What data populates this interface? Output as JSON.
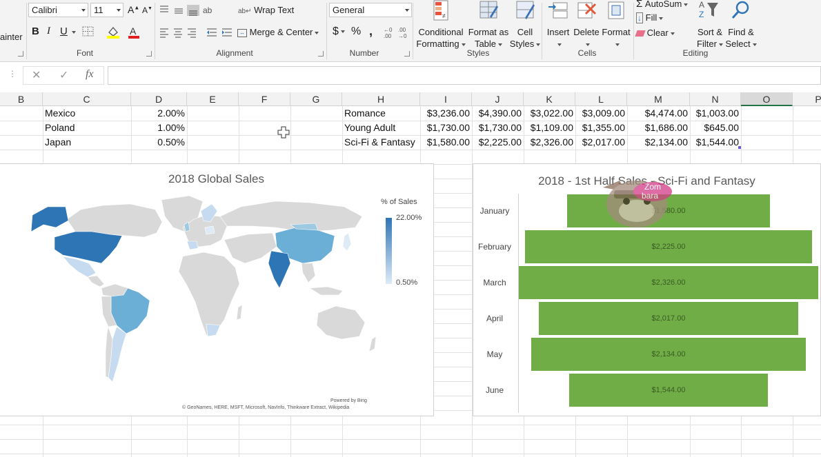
{
  "ribbon": {
    "clipboard_partial": "ainter",
    "font": {
      "name": "Calibri",
      "size": "11",
      "group_label": "Font"
    },
    "alignment": {
      "wrap_text": "Wrap Text",
      "merge_center": "Merge & Center",
      "group_label": "Alignment"
    },
    "number": {
      "format": "General",
      "currency": "$",
      "percent": "%",
      "comma": ",",
      "group_label": "Number"
    },
    "styles": {
      "conditional": [
        "Conditional",
        "Formatting"
      ],
      "format_table": [
        "Format as",
        "Table"
      ],
      "cell_styles": [
        "Cell",
        "Styles"
      ],
      "group_label": "Styles"
    },
    "cells": {
      "insert": "Insert",
      "delete": "Delete",
      "format": "Format",
      "group_label": "Cells"
    },
    "editing": {
      "autosum": "AutoSum",
      "fill": "Fill",
      "clear": "Clear",
      "sort": [
        "Sort &",
        "Filter"
      ],
      "find": [
        "Find &",
        "Select"
      ],
      "group_label": "Editing"
    }
  },
  "formula_bar": {
    "fx": "fx",
    "cancel": "✕",
    "enter": "✓",
    "value": ""
  },
  "columns": [
    "B",
    "C",
    "D",
    "E",
    "F",
    "G",
    "H",
    "I",
    "J",
    "K",
    "L",
    "M",
    "N",
    "O",
    "P"
  ],
  "rows": [
    {
      "country": "Mexico",
      "pct": "2.00%",
      "genre": "Romance",
      "vals": [
        "$3,236.00",
        "$4,390.00",
        "$3,022.00",
        "$3,009.00",
        "$4,474.00",
        "$1,003.00"
      ]
    },
    {
      "country": "Poland",
      "pct": "1.00%",
      "genre": "Young Adult",
      "vals": [
        "$1,730.00",
        "$1,730.00",
        "$1,109.00",
        "$1,355.00",
        "$1,686.00",
        "$645.00"
      ]
    },
    {
      "country": "Japan",
      "pct": "0.50%",
      "genre": "Sci-Fi & Fantasy",
      "vals": [
        "$1,580.00",
        "$2,225.00",
        "$2,326.00",
        "$2,017.00",
        "$2,134.00",
        "$1,544.00"
      ]
    }
  ],
  "map_chart": {
    "title": "2018 Global Sales",
    "legend_title": "% of Sales",
    "legend_max": "22.00%",
    "legend_min": "0.50%",
    "powered_by": "Powered by Bing",
    "attribution": "© GeoNames, HERE, MSFT, Microsoft, NavInfo, Thinkware Extract, Wikipedia",
    "colors": {
      "high": "#2e75b6",
      "low": "#deebf7",
      "land": "#d9d9d9"
    }
  },
  "watermark": "Zombara",
  "chart_data": {
    "type": "bar",
    "orientation": "horizontal",
    "title": "2018 - 1st Half Sales - Sci-Fi and Fantasy",
    "categories": [
      "January",
      "February",
      "March",
      "April",
      "May",
      "June"
    ],
    "values": [
      1580,
      2225,
      2326,
      2017,
      2134,
      1544
    ],
    "labels": [
      "$1,580.00",
      "$2,225.00",
      "$2,326.00",
      "$2,017.00",
      "$2,134.00",
      "$1,544.00"
    ],
    "color": "#70ad47",
    "centered": true
  }
}
